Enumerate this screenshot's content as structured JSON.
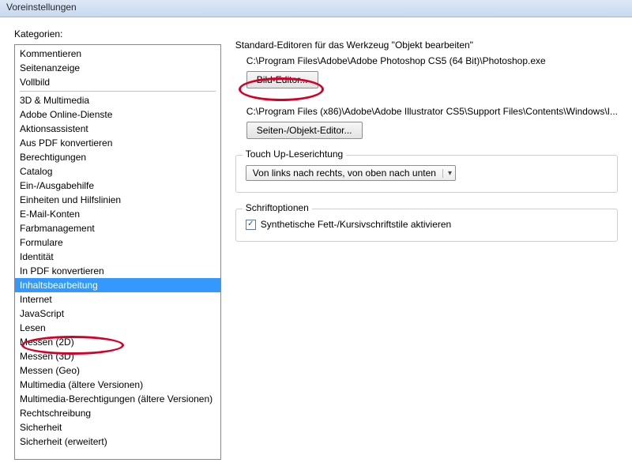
{
  "window": {
    "title": "Voreinstellungen"
  },
  "left": {
    "label": "Kategorien:",
    "groups": [
      [
        "Kommentieren",
        "Seitenanzeige",
        "Vollbild"
      ],
      [
        "3D & Multimedia",
        "Adobe Online-Dienste",
        "Aktionsassistent",
        "Aus PDF konvertieren",
        "Berechtigungen",
        "Catalog",
        "Ein-/Ausgabehilfe",
        "Einheiten und Hilfslinien",
        "E-Mail-Konten",
        "Farbmanagement",
        "Formulare",
        "Identität",
        "In PDF konvertieren",
        "Inhaltsbearbeitung",
        "Internet",
        "JavaScript",
        "Lesen",
        "Messen (2D)",
        "Messen (3D)",
        "Messen (Geo)",
        "Multimedia (ältere Versionen)",
        "Multimedia-Berechtigungen (ältere Versionen)",
        "Rechtschreibung",
        "Sicherheit",
        "Sicherheit (erweitert)"
      ]
    ],
    "selected": "Inhaltsbearbeitung"
  },
  "right": {
    "heading": "Standard-Editoren für das Werkzeug \"Objekt bearbeiten\"",
    "image_path": "C:\\Program Files\\Adobe\\Adobe Photoshop CS5 (64 Bit)\\Photoshop.exe",
    "image_btn": "Bild-Editor...",
    "page_path": "C:\\Program Files (x86)\\Adobe\\Adobe Illustrator CS5\\Support Files\\Contents\\Windows\\I...",
    "page_btn": "Seiten-/Objekt-Editor...",
    "touchup_title": "Touch Up-Leserichtung",
    "touchup_value": "Von links nach rechts, von oben nach unten",
    "fonts_title": "Schriftoptionen",
    "fonts_checkbox": "Synthetische Fett-/Kursivschriftstile aktivieren",
    "fonts_checked": true
  }
}
